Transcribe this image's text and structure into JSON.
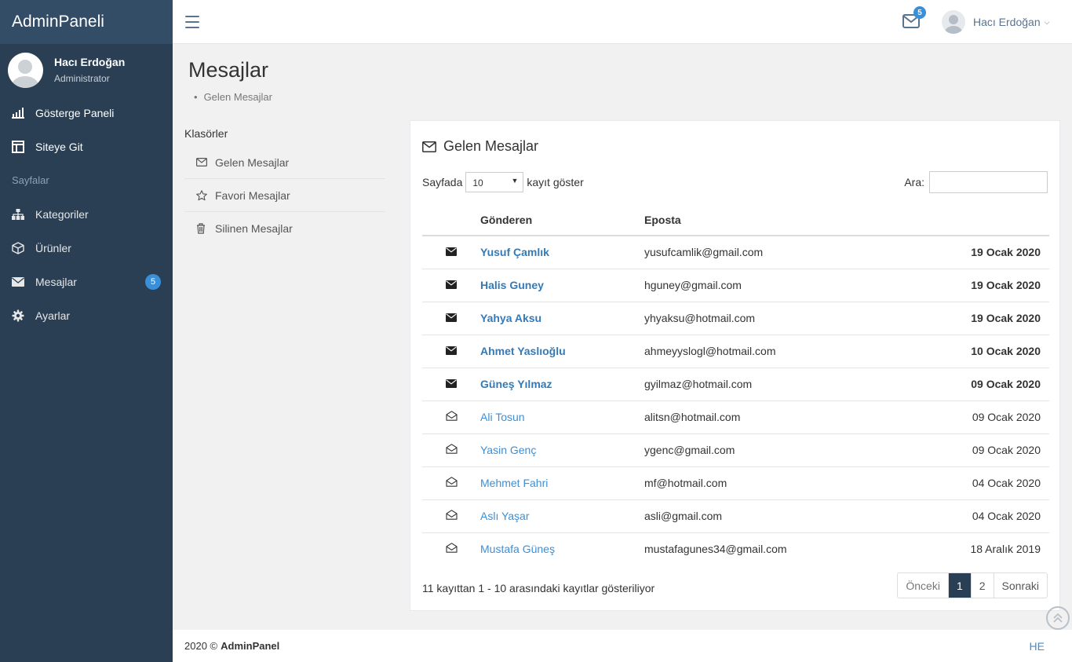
{
  "sidebar": {
    "brand": "AdminPaneli",
    "user_name": "Hacı Erdoğan",
    "user_role": "Administrator",
    "items_top": [
      {
        "label": "Gösterge Paneli",
        "icon": "bar-chart-icon"
      },
      {
        "label": "Siteye Git",
        "icon": "layout-icon"
      }
    ],
    "section_label": "Sayfalar",
    "items": [
      {
        "label": "Kategoriler",
        "icon": "sitemap-icon"
      },
      {
        "label": "Ürünler",
        "icon": "cube-icon"
      },
      {
        "label": "Mesajlar",
        "icon": "envelope-icon",
        "badge": "5"
      },
      {
        "label": "Ayarlar",
        "icon": "gear-icon"
      }
    ]
  },
  "topbar": {
    "mail_badge": "5",
    "user_name": "Hacı Erdoğan"
  },
  "page": {
    "title": "Mesajlar",
    "breadcrumb": "Gelen Mesajlar"
  },
  "folders": {
    "title": "Klasörler",
    "items": [
      {
        "label": "Gelen Mesajlar",
        "icon": "envelope-outline-icon"
      },
      {
        "label": "Favori Mesajlar",
        "icon": "star-outline-icon"
      },
      {
        "label": "Silinen Mesajlar",
        "icon": "trash-icon"
      }
    ]
  },
  "panel": {
    "title": "Gelen Mesajlar",
    "length_prefix": "Sayfada",
    "length_value": "10",
    "length_suffix": "kayıt göster",
    "search_label": "Ara:",
    "search_value": "",
    "columns": [
      "",
      "Gönderen",
      "Eposta",
      ""
    ],
    "rows": [
      {
        "name": "Yusuf Çamlık",
        "email": "yusufcamlik@gmail.com",
        "date": "19 Ocak 2020",
        "read": false
      },
      {
        "name": "Halis Guney",
        "email": "hguney@gmail.com",
        "date": "19 Ocak 2020",
        "read": false
      },
      {
        "name": "Yahya Aksu",
        "email": "yhyaksu@hotmail.com",
        "date": "19 Ocak 2020",
        "read": false
      },
      {
        "name": "Ahmet Yaslıoğlu",
        "email": "ahmeyyslogl@hotmail.com",
        "date": "10 Ocak 2020",
        "read": false
      },
      {
        "name": "Güneş Yılmaz",
        "email": "gyilmaz@hotmail.com",
        "date": "09 Ocak 2020",
        "read": false
      },
      {
        "name": "Ali Tosun",
        "email": "alitsn@hotmail.com",
        "date": "09 Ocak 2020",
        "read": true
      },
      {
        "name": "Yasin Genç",
        "email": "ygenc@gmail.com",
        "date": "09 Ocak 2020",
        "read": true
      },
      {
        "name": "Mehmet Fahri",
        "email": "mf@hotmail.com",
        "date": "04 Ocak 2020",
        "read": true
      },
      {
        "name": "Aslı Yaşar",
        "email": "asli@gmail.com",
        "date": "04 Ocak 2020",
        "read": true
      },
      {
        "name": "Mustafa Güneş",
        "email": "mustafagunes34@gmail.com",
        "date": "18 Aralık 2019",
        "read": true
      }
    ],
    "info": "11 kayıttan 1 - 10 arasındaki kayıtlar gösteriliyor",
    "pagination": {
      "prev": "Önceki",
      "pages": [
        "1",
        "2"
      ],
      "active": "1",
      "next": "Sonraki"
    }
  },
  "footer": {
    "copyright": "2020 ©",
    "brand": "AdminPanel",
    "right": "HE"
  },
  "colors": {
    "sidebar_bg": "#2a3f54",
    "brand_bg": "#344d66",
    "accent": "#3a8fd9",
    "link": "#337ab7"
  }
}
